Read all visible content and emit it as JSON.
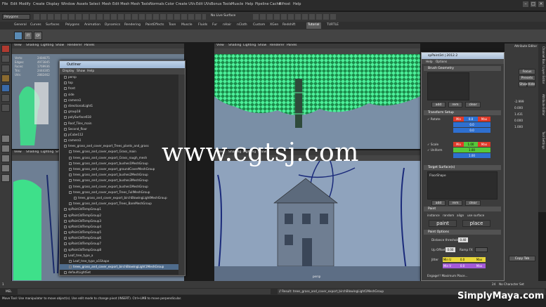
{
  "menu": [
    "File",
    "Edit",
    "Modify",
    "Create",
    "Display",
    "Window",
    "Assets",
    "Select",
    "Mesh",
    "Edit Mesh",
    "Mesh Tools",
    "Normals",
    "Color",
    "Create UVs",
    "Edit UVs",
    "Bonus Tools",
    "Muscle",
    "Help",
    "Pipeline Cache",
    "Bifrost",
    "Help"
  ],
  "status": {
    "mode": "Polygons",
    "live": "No Live Surface"
  },
  "shelf_tabs": [
    "General",
    "Curves",
    "Surfaces",
    "Polygons",
    "Animation",
    "Dynamics",
    "Rendering",
    "PaintEffects",
    "Toon",
    "Muscle",
    "Fluids",
    "Fur",
    "nHair",
    "nCloth",
    "Custom",
    "XGen",
    "Redshift",
    "Tutorial",
    "TURTLE"
  ],
  "shelf_active": "Tutorial",
  "viewport_menu": [
    "View",
    "Shading",
    "Lighting",
    "Show",
    "Renderer",
    "Panels"
  ],
  "hud": {
    "labels": [
      "Verts:",
      "Edges:",
      "Faces:",
      "Tris:",
      "UVs:"
    ],
    "vals": [
      "2484875",
      "4973845",
      "1769936",
      "2444305",
      "2882462"
    ]
  },
  "persp_label": "persp",
  "attr_editor_label": "Attribute Editor",
  "outliner": {
    "title": "Outliner",
    "menu": [
      "Display",
      "Show",
      "Help"
    ],
    "rows": [
      "persp",
      "top",
      "front",
      "side",
      "camera1",
      "directionalLight1",
      "group18",
      "polySurface618",
      "Roof_Tiles_main",
      "Second_floor",
      "pCube112",
      "camera1",
      "trees_grass_and_cover_export_Trees_plants_and_grass",
      "trees_grass_and_cover_export_Grass_main",
      "trees_grass_and_cover_export_Grass_rough_mesh",
      "trees_grass_and_cover_export_bushes1MeshGroup",
      "trees_grass_and_cover_export_groundCoverMeshGroup",
      "trees_grass_and_cover_export_bushes2MeshGroup",
      "trees_grass_and_cover_export_bushes3MeshGroup",
      "trees_grass_and_cover_export_bushes1MeshGroup",
      "trees_grass_and_cover_export_Trees_FullMeshGroup",
      "trees_grass_and_cover_export_birchBlowingLightMeshGroup",
      "trees_grass_and_cover_export_Trees_BareMeshGroup",
      "spPaint3dTempGroup1",
      "spPaint3dTempGroup2",
      "spPaint3dTempGroup3",
      "spPaint3dTempGroup4",
      "spPaint3dTempGroup5",
      "spPaint3dTempGroup6",
      "spPaint3dTempGroup7",
      "spPaint3dTempGroup8",
      "Leaf_tree_type_a",
      "Leaf_tree_type_a1Shape",
      "trees_grass_and_cover_export_birchBlowingLight1MeshGroup",
      "defaultLightSet",
      "defaultObjectSet"
    ],
    "selected_index": 33
  },
  "spaint": {
    "title": "spPaint3d | 2012.2",
    "menu": [
      "Help",
      "Options"
    ],
    "sec_brush": "Brush Geometry",
    "add": "add",
    "remove": "rem",
    "clear": "clear",
    "sec_transform": "Transform Setup",
    "rotate": "Rotate",
    "scale": "Scale",
    "uniform": "Uniform",
    "min": "Min",
    "max": "Max",
    "rot_vals": [
      "0.0",
      "0.0",
      "0.0"
    ],
    "scale_vals": [
      "1.00",
      "1.00",
      "1.00"
    ],
    "sec_target": "Target Surface(s)",
    "target": "FloorShape",
    "sec_paint": "Paint",
    "paint_opts": [
      "instance",
      "random",
      "align",
      "use surface"
    ],
    "paint_btn": "paint",
    "place_btn": "place",
    "sec_options": "Paint Options",
    "distance_label": "Distance threshold",
    "distance_val": "0.40",
    "upoffset_label": "Up Offset",
    "upoffset_val": "0.00",
    "ramp_label": "Ramp FX",
    "jitter_label": "Jitter",
    "jitter_vals": [
      "Min U",
      "0.0",
      "Max"
    ],
    "jitter_vals2": [
      "Min V",
      "0.0",
      "Max"
    ],
    "footer": "Engage!! Maximum Place..."
  },
  "channel": {
    "vals": [
      "-2.999",
      "0.000",
      "1.431",
      "0.000",
      "1.000"
    ],
    "tabs": [
      "Channel Box / Layer Editor",
      "Attribute Editor",
      "Tool Settings"
    ],
    "btns": [
      "Focus",
      "Presets",
      "Show",
      "Hide"
    ],
    "copytab": "Copy Tab"
  },
  "timeline": {
    "start": "1",
    "end": "24",
    "result": "// Result: trees_grass_and_cover_export_birchBlowingLight1MeshGroup"
  },
  "cmd": "MEL",
  "help": "Move Tool: Use manipulator to move object(s). Use edit mode to change pivot (INSERT). Ctrl+LMB to move perpendicular.",
  "character_set": "No Character Set",
  "watermark": "www.cgtsj.com",
  "brand": "SimplyMaya.com",
  "colors": {
    "foliage": "#3ee08a",
    "rotate_min": "#e03a2a",
    "rotate_max": "#e03a2a",
    "field_blue": "#2e6fd0",
    "field_green": "#56c93a",
    "field_yellow": "#e8d73a",
    "field_purple": "#a45ad8"
  }
}
